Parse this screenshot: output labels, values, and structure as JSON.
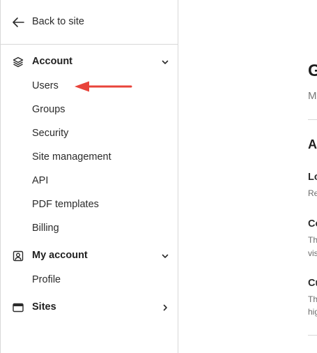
{
  "sidebar": {
    "back_label": "Back to site",
    "sections": [
      {
        "label": "Account",
        "icon": "layers-icon",
        "expanded": true,
        "items": [
          "Users",
          "Groups",
          "Security",
          "Site management",
          "API",
          "PDF templates",
          "Billing"
        ]
      },
      {
        "label": "My account",
        "icon": "user-square-icon",
        "expanded": true,
        "items": [
          "Profile"
        ]
      },
      {
        "label": "Sites",
        "icon": "browser-window-icon",
        "expanded": false,
        "items": []
      }
    ]
  },
  "main": {
    "title": "G",
    "subtitle": "M",
    "section_heading": "A",
    "options": [
      {
        "title": "Lo",
        "desc": [
          "Re"
        ]
      },
      {
        "title": "Co",
        "desc": [
          "Th",
          "vis"
        ]
      },
      {
        "title": "Cu",
        "desc": [
          "Th",
          "hig"
        ]
      }
    ]
  },
  "annotation": {
    "arrow_color": "#e8433a",
    "points_to": "Users"
  },
  "colors": {
    "border": "#d8d8d8",
    "text": "#1f1f1f",
    "muted": "#6b6b6b"
  }
}
